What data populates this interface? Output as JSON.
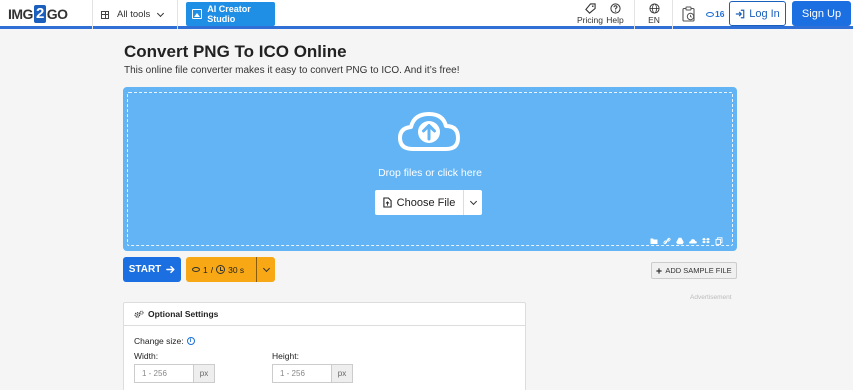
{
  "header": {
    "logo_pre": "IMG",
    "logo_num": "2",
    "logo_post": "GO",
    "all_tools": "All tools",
    "ai_studio": "AI Creator Studio",
    "pricing": "Pricing",
    "help": "Help",
    "language": "EN",
    "credits": "16",
    "login": "Log In",
    "signup": "Sign Up"
  },
  "main": {
    "title": "Convert PNG To ICO Online",
    "subtitle": "This online file converter makes it easy to convert PNG to ICO. And it’s free!",
    "drop_text": "Drop files or click here",
    "choose_file": "Choose File",
    "start": "START",
    "cost_credits": "1",
    "cost_sep": "/",
    "cost_time": "30 s",
    "add_sample": "ADD SAMPLE FILE",
    "advertisement": "Advertisement"
  },
  "settings": {
    "title": "Optional Settings",
    "change_size": "Change size:",
    "width_label": "Width:",
    "height_label": "Height:",
    "width_placeholder": "1 - 256",
    "height_placeholder": "1 - 256",
    "unit": "px"
  },
  "colors": {
    "brand_blue": "#1b6fe0",
    "dropzone": "#62b4f5",
    "ai_button": "#1f8fe6",
    "cost_orange": "#f7a814"
  }
}
